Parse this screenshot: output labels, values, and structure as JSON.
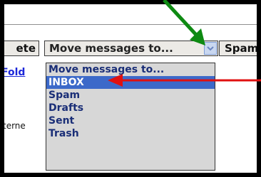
{
  "toolbar": {
    "delete_label": "ete",
    "spam_label": "Spam",
    "move_select": {
      "selected": "Move messages to..."
    }
  },
  "left_panel": {
    "link_text": "Fold",
    "text_fragment": "terne"
  },
  "dropdown": {
    "options": [
      "Move messages to...",
      "INBOX",
      "Spam",
      "Drafts",
      "Sent",
      "Trash"
    ],
    "selected_index": 1
  },
  "colors": {
    "highlight": "#3c69c9",
    "annotation_green": "#0e8a12",
    "annotation_red": "#e01010",
    "link": "#1d28d9"
  },
  "icons": [
    "chevron-down-icon",
    "green-arrow-annotation",
    "red-arrow-annotation"
  ]
}
